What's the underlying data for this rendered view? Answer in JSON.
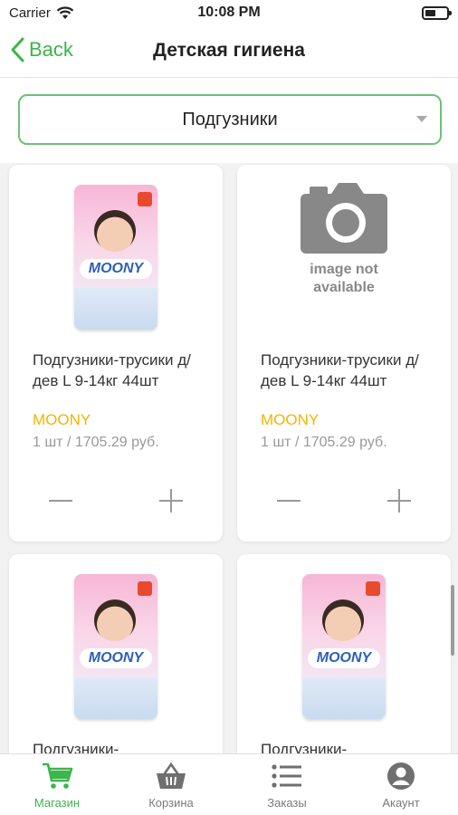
{
  "status_bar": {
    "carrier": "Carrier",
    "time": "10:08 PM"
  },
  "nav": {
    "back_label": "Back",
    "title": "Детская гигиена"
  },
  "filter": {
    "selected": "Подгузники"
  },
  "products": [
    {
      "name": "Подгузники-трусики д/дев L 9-14кг 44шт",
      "brand": "MOONY",
      "price": "1 шт / 1705.29 руб.",
      "image": "product-photo"
    },
    {
      "name": "Подгузники-трусики д/дев L 9-14кг 44шт",
      "brand": "MOONY",
      "price": "1 шт / 1705.29 руб.",
      "image": "no-image-placeholder",
      "image_text_1": "image not",
      "image_text_2": "available"
    },
    {
      "name": "Подгузники-",
      "image": "product-photo"
    },
    {
      "name": "Подгузники-",
      "image": "product-photo"
    }
  ],
  "tabs": [
    {
      "label": "Магазин",
      "icon": "cart-icon",
      "active": true
    },
    {
      "label": "Корзина",
      "icon": "basket-icon",
      "active": false
    },
    {
      "label": "Заказы",
      "icon": "list-icon",
      "active": false
    },
    {
      "label": "Акаунт",
      "icon": "account-icon",
      "active": false
    }
  ],
  "colors": {
    "accent": "#3cb54a",
    "brand_text": "#f5b400",
    "price_text": "#999999"
  }
}
